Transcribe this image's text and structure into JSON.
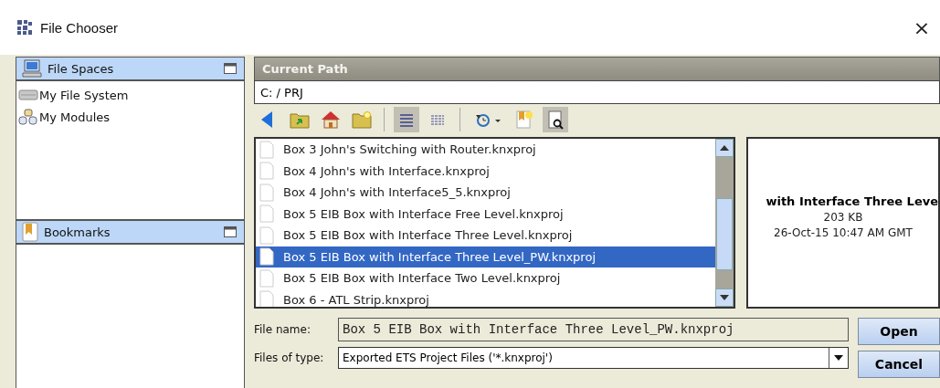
{
  "window": {
    "title": "File Chooser",
    "close": "×"
  },
  "sidebar": {
    "sections": [
      {
        "title": "File Spaces",
        "kind": "spaces",
        "items": [
          {
            "label": "My File System",
            "kind": "drive"
          },
          {
            "label": "My Modules",
            "kind": "modules"
          }
        ]
      },
      {
        "title": "Bookmarks",
        "kind": "bookmarks"
      }
    ]
  },
  "current_path": {
    "title": "Current Path",
    "value": "C: / PRJ"
  },
  "toolbar": {
    "list_view_pressed": true,
    "details_view_pressed": false,
    "preview_pressed": true
  },
  "files": [
    {
      "name": "Box 3 John's Switching with Router.knxproj",
      "selected": false
    },
    {
      "name": "Box 4 John's with Interface.knxproj",
      "selected": false
    },
    {
      "name": "Box 4 John's with Interface5_5.knxproj",
      "selected": false
    },
    {
      "name": "Box 5 EIB Box with Interface Free Level.knxproj",
      "selected": false
    },
    {
      "name": "Box 5 EIB Box with Interface Three Level.knxproj",
      "selected": false
    },
    {
      "name": "Box 5 EIB Box with Interface Three Level_PW.knxproj",
      "selected": true
    },
    {
      "name": "Box 5 EIB Box with Interface Two Level.knxproj",
      "selected": false
    },
    {
      "name": "Box 6 - ATL Strip.knxproj",
      "selected": false
    }
  ],
  "preview": {
    "name": "with Interface Three Leve",
    "size": "203 KB",
    "date": "26-Oct-15 10:47 AM GMT"
  },
  "file_name": {
    "label": "File name:",
    "value": "Box 5 EIB Box with Interface Three Level_PW.knxproj"
  },
  "file_type": {
    "label": "Files of type:",
    "value": "Exported ETS Project Files ('*.knxproj')"
  },
  "buttons": [
    "Open",
    "Cancel"
  ]
}
